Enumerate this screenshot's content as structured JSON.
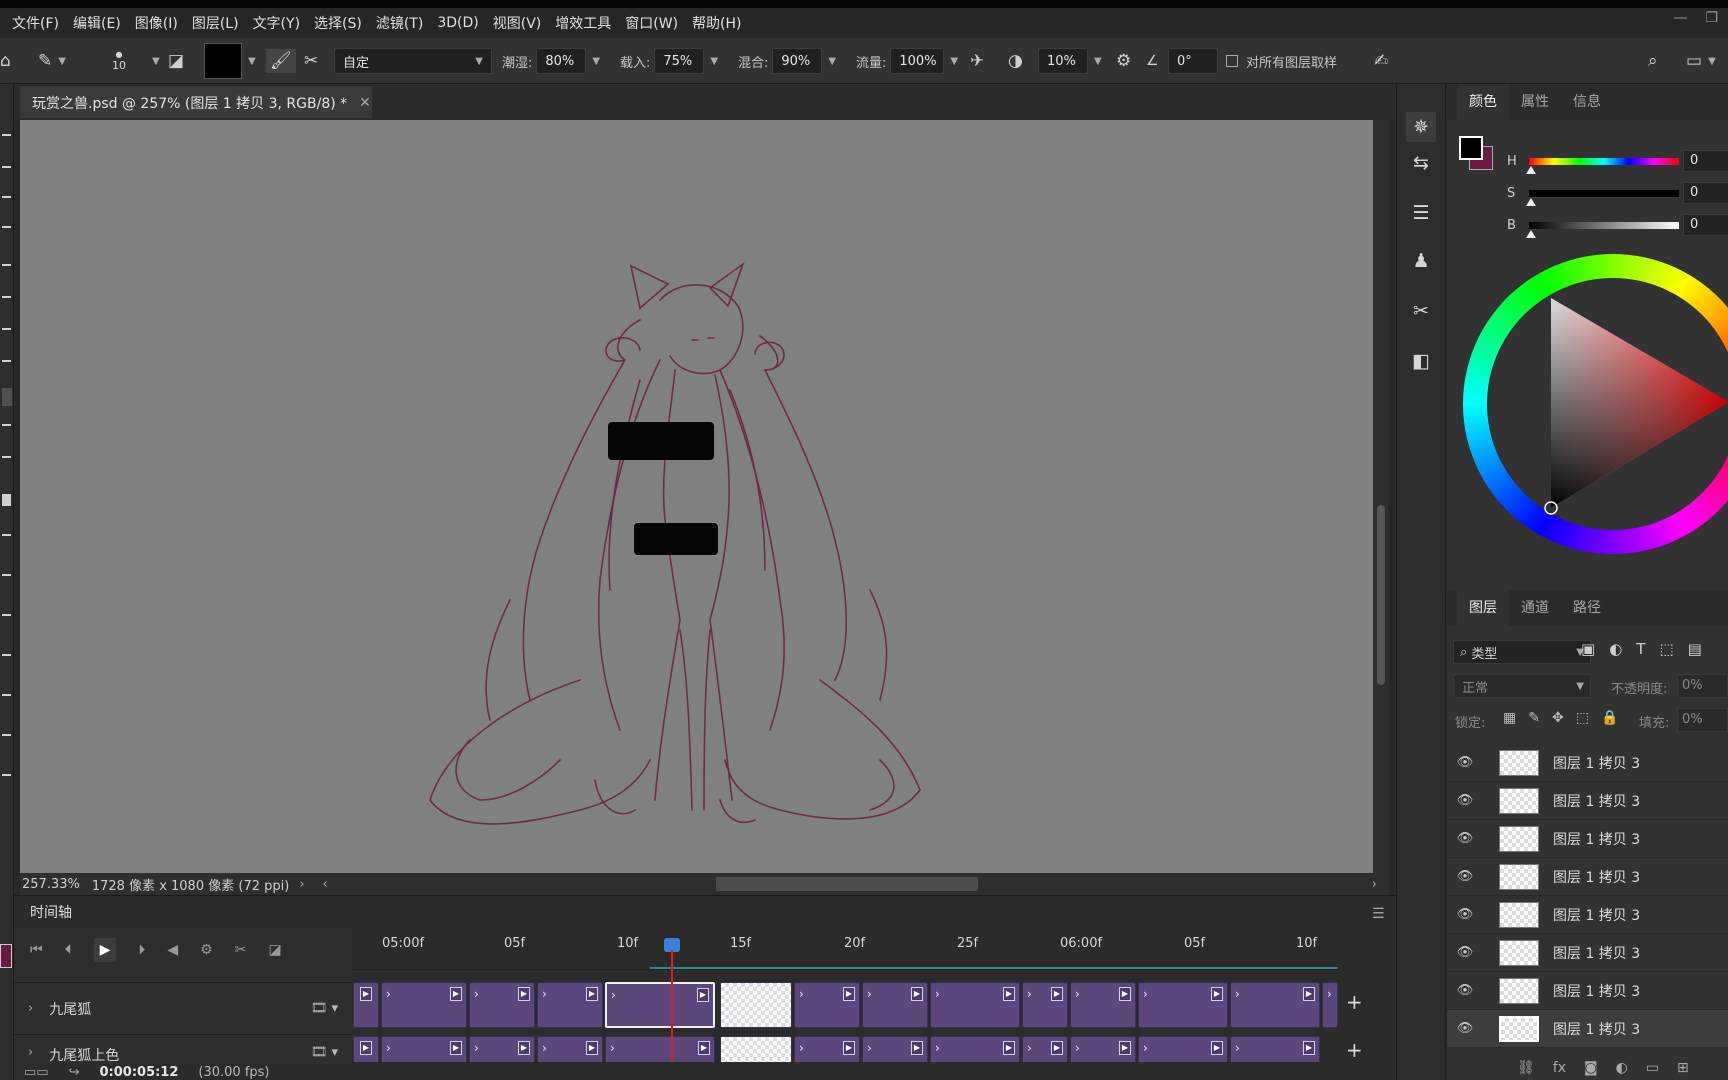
{
  "menu": [
    "文件(F)",
    "编辑(E)",
    "图像(I)",
    "图层(L)",
    "文字(Y)",
    "选择(S)",
    "滤镜(T)",
    "3D(D)",
    "视图(V)",
    "增效工具",
    "窗口(W)",
    "帮助(H)"
  ],
  "options": {
    "brush_size": "10",
    "preset": "自定",
    "wet_label": "潮湿:",
    "wet_value": "80%",
    "load_label": "载入:",
    "load_value": "75%",
    "mix_label": "混合:",
    "mix_value": "90%",
    "flow_label": "流量:",
    "flow_value": "100%",
    "smooth_value": "10%",
    "angle_value": "0°",
    "sample_all_label": "对所有图层取样"
  },
  "document": {
    "tab_title": "玩赏之兽.psd @ 257% (图层 1 拷贝 3, RGB/8) *",
    "zoom": "257.33%",
    "info": "1728 像素 x 1080 像素 (72 ppi)"
  },
  "color_panel": {
    "tabs": [
      "颜色",
      "属性",
      "信息"
    ],
    "h_label": "H",
    "h_value": "0",
    "s_label": "S",
    "s_value": "0",
    "b_label": "B",
    "b_value": "0",
    "foreground": "#000000",
    "background": "#6b1a45"
  },
  "layers_panel": {
    "tabs": [
      "图层",
      "通道",
      "路径"
    ],
    "filter": "类型",
    "blend_mode": "正常",
    "opacity_label": "不透明度:",
    "opacity_value": "0%",
    "lock_label": "锁定:",
    "fill_label": "填充:",
    "fill_value": "0%",
    "layers": [
      {
        "name": "图层 1 拷贝 3"
      },
      {
        "name": "图层 1 拷贝 3"
      },
      {
        "name": "图层 1 拷贝 3"
      },
      {
        "name": "图层 1 拷贝 3"
      },
      {
        "name": "图层 1 拷贝 3"
      },
      {
        "name": "图层 1 拷贝 3"
      },
      {
        "name": "图层 1 拷贝 3"
      },
      {
        "name": "图层 1 拷贝 3"
      }
    ]
  },
  "timeline": {
    "title": "时间轴",
    "ruler": [
      "05:00f",
      "05f",
      "10f",
      "15f",
      "20f",
      "25f",
      "06:00f",
      "05f",
      "10f"
    ],
    "track1": "九尾狐",
    "track2": "九尾狐上色",
    "timecode": "0:00:05:12",
    "fps": "(30.00 fps)"
  }
}
